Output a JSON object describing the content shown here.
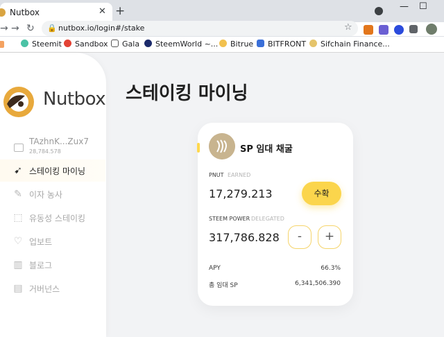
{
  "browser": {
    "tab_title": "Nutbox",
    "tab_close": "✕",
    "new_tab": "+",
    "url": "nutbox.io/login#/stake",
    "bookmarks": [
      "Steemit",
      "Sandbox",
      "Gala",
      "SteemWorld ~...",
      "Bitrue",
      "BITFRONT",
      "Sifchain Finance..."
    ],
    "window_buttons": [
      "—",
      "☐"
    ]
  },
  "sidebar": {
    "logo_text": "Nutbox",
    "account_name": "TAzhnK...Zux7",
    "account_balance": "28,784.578",
    "items": [
      {
        "label": "스테이킹 마이닝",
        "active": true
      },
      {
        "label": "이자 농사",
        "active": false
      },
      {
        "label": "유동성 스테이킹",
        "active": false
      },
      {
        "label": "업보트",
        "active": false
      },
      {
        "label": "블로그",
        "active": false
      },
      {
        "label": "거버넌스",
        "active": false
      }
    ]
  },
  "main": {
    "title": "스테이킹 마이닝"
  },
  "card": {
    "title": "SP 임대 채굴",
    "earned": {
      "label": "PNUT",
      "sub": "EARNED",
      "value": "17,279.213",
      "button": "수확"
    },
    "delegated": {
      "label": "STEEM POWER",
      "sub": "DELEGATED",
      "value": "317,786.828",
      "minus": "-",
      "plus": "+"
    },
    "apy": {
      "label": "APY",
      "value": "66.3%"
    },
    "total": {
      "label": "총 임대 SP",
      "value": "6,341,506.390"
    }
  },
  "colors": {
    "accent": "#fbd54c",
    "background": "#f2f3f5"
  }
}
